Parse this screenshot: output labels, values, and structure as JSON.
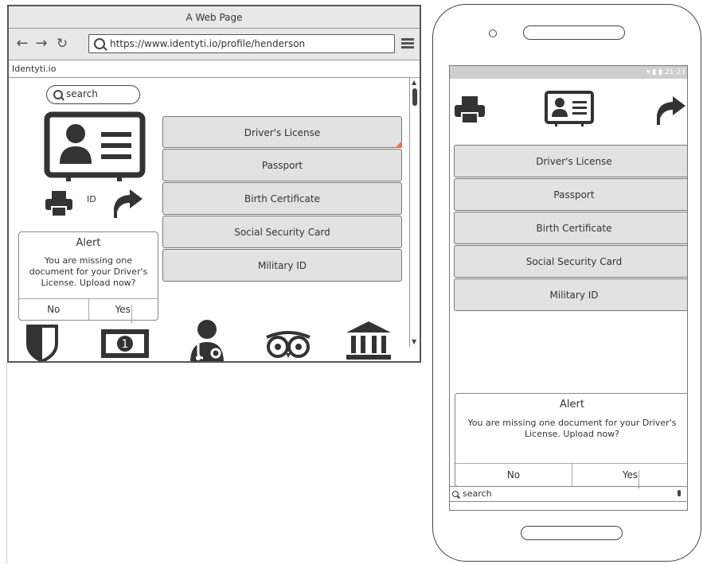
{
  "browser": {
    "window_title": "A Web Page",
    "url": "https://www.identyti.io/profile/henderson",
    "site_name": "Identyti.io",
    "search_placeholder": "search",
    "id_label": "ID",
    "documents": [
      "Driver's License",
      "Passport",
      "Birth Certificate",
      "Social Security Card",
      "Military ID"
    ],
    "alert": {
      "title": "Alert",
      "message": "You are missing one document for your Driver's License. Upload now?",
      "no_label": "No",
      "yes_label": "Yes"
    },
    "bottom_icons": [
      "shield-icon",
      "money-icon",
      "doctor-icon",
      "owl-icon",
      "bank-icon"
    ]
  },
  "phone": {
    "status_time": "21:23",
    "documents": [
      "Driver's License",
      "Passport",
      "Birth Certificate",
      "Social Security Card",
      "Military ID"
    ],
    "alert": {
      "title": "Alert",
      "message": "You are missing one document for your Driver's License. Upload now?",
      "no_label": "No",
      "yes_label": "Yes"
    },
    "search_placeholder": "search"
  },
  "colors": {
    "accent": "#e8734f",
    "icon": "#333333",
    "button_bg": "#e2e2e2",
    "statusbar": "#cfcfcf"
  }
}
